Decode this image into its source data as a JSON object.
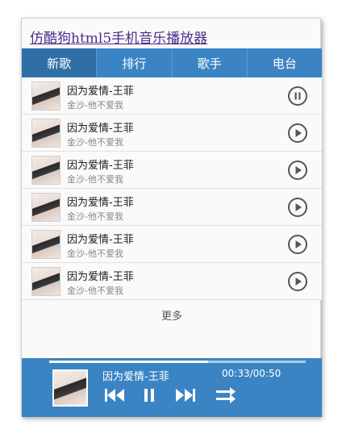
{
  "app": {
    "title": "仿酷狗html5手机音乐播放器"
  },
  "tabs": [
    {
      "label": "新歌"
    },
    {
      "label": "排行"
    },
    {
      "label": "歌手"
    },
    {
      "label": "电台"
    }
  ],
  "songs": [
    {
      "title": "因为爱情-王菲",
      "sub": "金沙-他不爱我",
      "state": "pause"
    },
    {
      "title": "因为爱情-王菲",
      "sub": "金沙-他不爱我",
      "state": "play"
    },
    {
      "title": "因为爱情-王菲",
      "sub": "金沙-他不爱我",
      "state": "play"
    },
    {
      "title": "因为爱情-王菲",
      "sub": "金沙-他不爱我",
      "state": "play"
    },
    {
      "title": "因为爱情-王菲",
      "sub": "金沙-他不爱我",
      "state": "play"
    },
    {
      "title": "因为爱情-王菲",
      "sub": "金沙-他不爱我",
      "state": "play"
    }
  ],
  "more_label": "更多",
  "player": {
    "title": "因为爱情-王菲",
    "time": "00:33/00:50",
    "progress": 0.62
  },
  "colors": {
    "accent": "#3b84c4",
    "accent_dark": "#2f6fa8"
  },
  "icons": {
    "prev": "previous-icon",
    "pause": "pause-icon",
    "next": "next-icon",
    "mode": "shuffle-icon"
  }
}
